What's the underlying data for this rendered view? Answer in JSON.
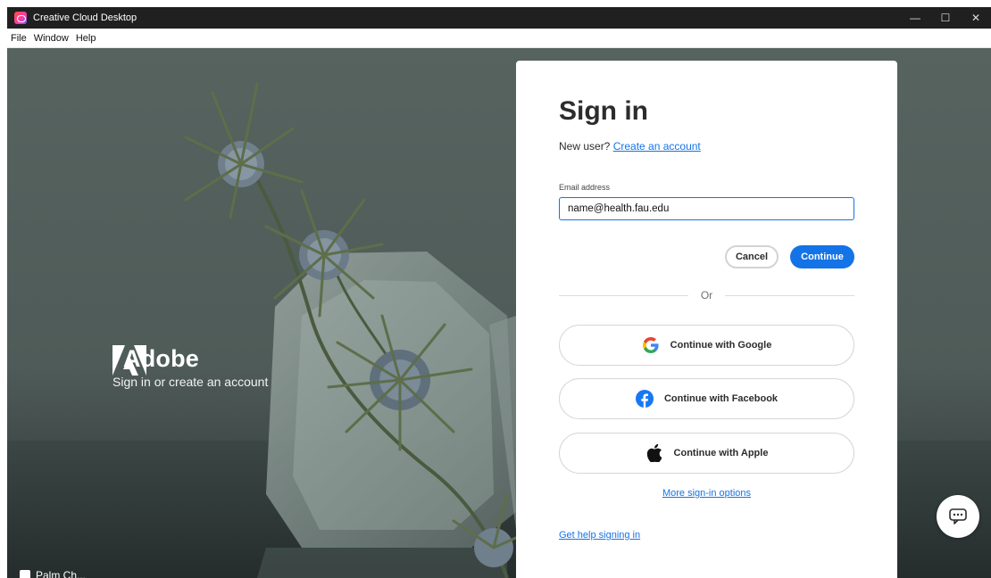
{
  "window": {
    "title": "Creative Cloud Desktop",
    "minimize": "—",
    "maximize": "☐",
    "close": "✕"
  },
  "menu": {
    "items": [
      {
        "label": "File"
      },
      {
        "label": "Window"
      },
      {
        "label": "Help"
      }
    ]
  },
  "brand": {
    "name": "Adobe",
    "tagline": "Sign in or create an account",
    "bottom_label": "Palm Ch..."
  },
  "signin": {
    "heading": "Sign in",
    "new_user_text": "New user?",
    "create_account_link": "Create an account",
    "email_label": "Email address",
    "email_value": "name@health.fau.edu",
    "cancel_label": "Cancel",
    "continue_label": "Continue",
    "or_text": "Or",
    "google_label": "Continue with Google",
    "facebook_label": "Continue with Facebook",
    "apple_label": "Continue with Apple",
    "more_options_link": "More sign-in options",
    "help_link": "Get help signing in"
  },
  "colors": {
    "accent": "#1473e6",
    "titlebar": "#202020",
    "background": "#56635f"
  }
}
